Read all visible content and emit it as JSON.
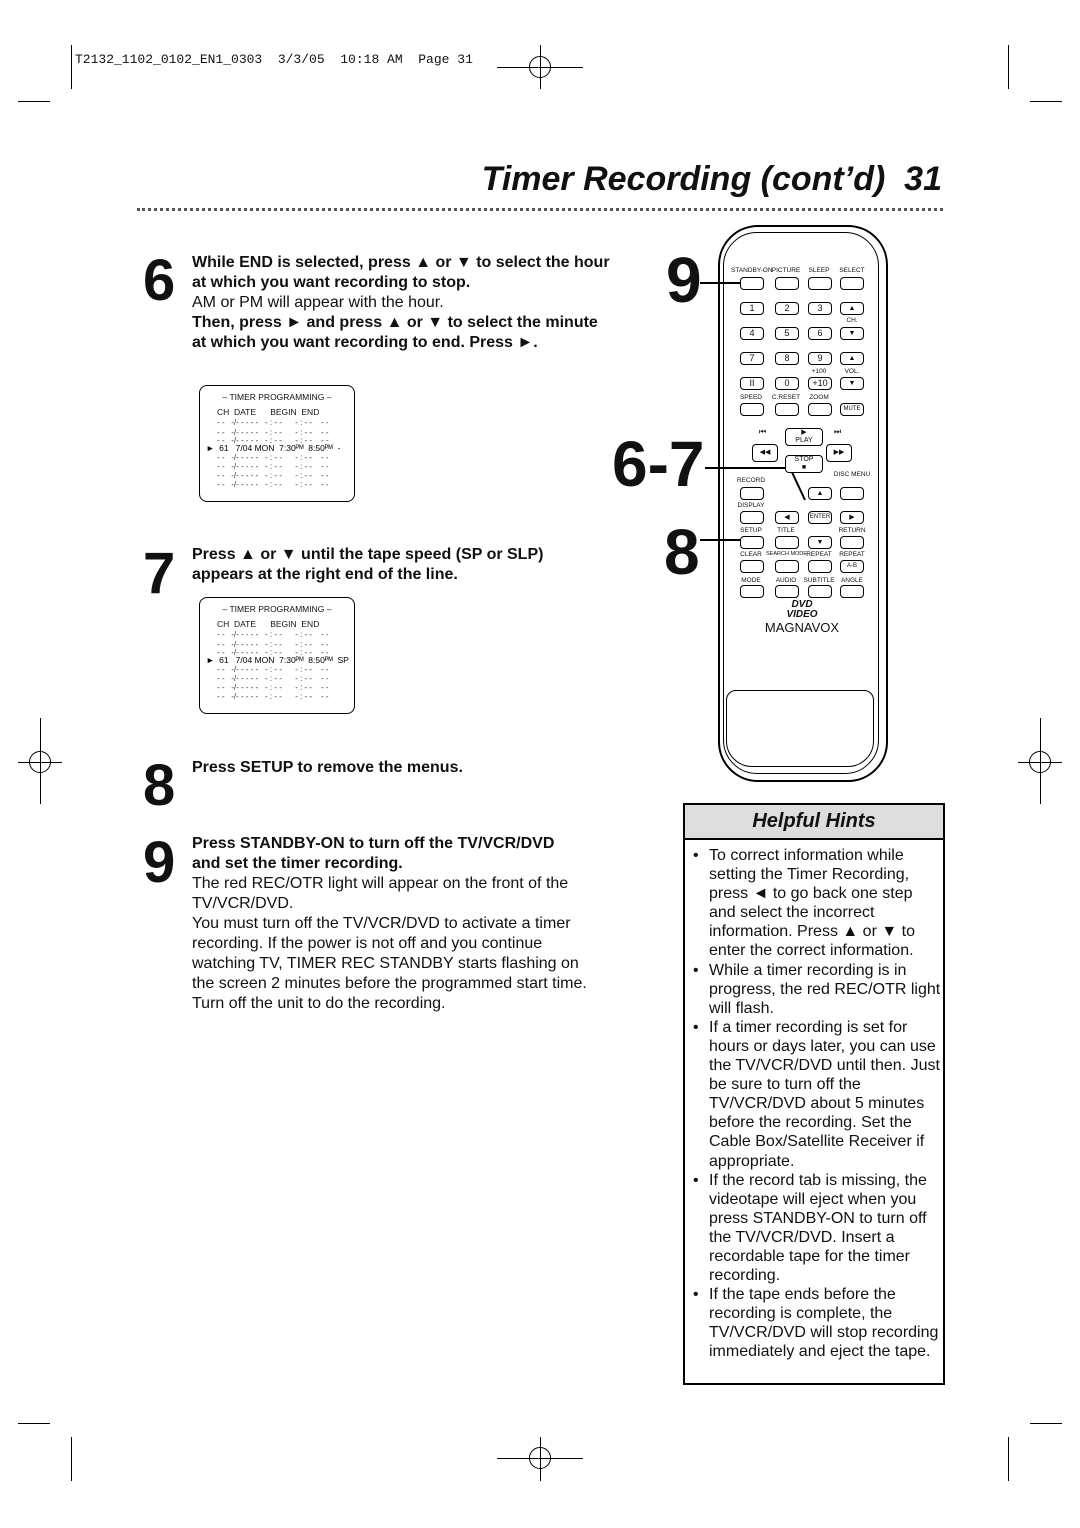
{
  "slug": "T2132_1102_0102_EN1_0303  3/3/05  10:18 AM  Page 31",
  "title": "Timer Recording (cont’d)  31",
  "steps": [
    {
      "num": "6",
      "bold1": "While END is selected, press ▲ or ▼ to select the hour at which you want recording to stop.",
      "text1": "AM or PM will appear with the hour.",
      "bold2": "Then, press ► and press ▲ or ▼ to select the minute at which you want recording to end. Press ►."
    },
    {
      "num": "7",
      "bold1": "Press ▲ or ▼ until the tape speed (SP or SLP) appears at the right end of the line."
    },
    {
      "num": "8",
      "bold1": "Press SETUP to remove the menus."
    },
    {
      "num": "9",
      "bold1": "Press STANDBY-ON to turn off the TV/VCR/DVD and set the timer recording.",
      "text1": "The red REC/OTR light will appear on the front of the TV/VCR/DVD.",
      "text2": "You must turn off the TV/VCR/DVD to activate a timer recording. If the power is not off and you continue watching TV, TIMER REC STANDBY starts flashing on the screen 2 minutes before the programmed start time. Turn off the unit to do the recording."
    }
  ],
  "timer_screen": {
    "title": "– TIMER PROGRAMMING –",
    "header": "CH  DATE      BEGIN  END",
    "empty_row": "- -   -/- - - - -   - : - -      - : - -    - -",
    "screen1_selected": "►  61   7/04 MON  7:30ᴾᴹ  8:50ᴾᴹ  -",
    "screen2_selected": "►  61   7/04 MON  7:30ᴾᴹ  8:50ᴾᴹ  SP"
  },
  "callouts": {
    "a": "9",
    "b": "6-7",
    "c": "8"
  },
  "remote": {
    "labels": [
      "STANDBY-ON",
      "PICTURE",
      "SLEEP",
      "SELECT",
      "CH.",
      "+100",
      "VOL.",
      "SPEED",
      "C.RESET",
      "ZOOM",
      "MUTE",
      "PLAY",
      "STOP",
      "RECORD",
      "DISC MENU",
      "DISPLAY",
      "ENTER",
      "SETUP",
      "TITLE",
      "RETURN",
      "CLEAR",
      "SEARCH MODE",
      "REPEAT",
      "REPEAT",
      "A-B",
      "MODE",
      "AUDIO",
      "SUBTITLE",
      "ANGLE"
    ],
    "keys": [
      "1",
      "2",
      "3",
      "4",
      "5",
      "6",
      "7",
      "8",
      "9",
      "II",
      "0",
      "+10"
    ],
    "dvd_logo": "DVD VIDEO",
    "brand": "MAGNAVOX"
  },
  "hints": {
    "title": "Helpful Hints",
    "items": [
      "To correct information while setting the Timer Recording, press ◄ to go back one step and select the incorrect information. Press ▲ or ▼ to enter the correct information.",
      "While a timer recording is in progress, the red REC/OTR light will flash.",
      "If a timer recording is set for hours or days later, you can use the TV/VCR/DVD until then. Just be sure to turn off the TV/VCR/DVD about 5 minutes before the recording. Set the Cable Box/Satellite Receiver if appropriate.",
      "If the record tab is missing, the videotape will eject when you press STANDBY-ON to turn off the TV/VCR/DVD. Insert a recordable tape for the timer recording.",
      "If the tape ends before the recording is complete, the TV/VCR/DVD will stop recording immediately and eject the tape."
    ]
  }
}
